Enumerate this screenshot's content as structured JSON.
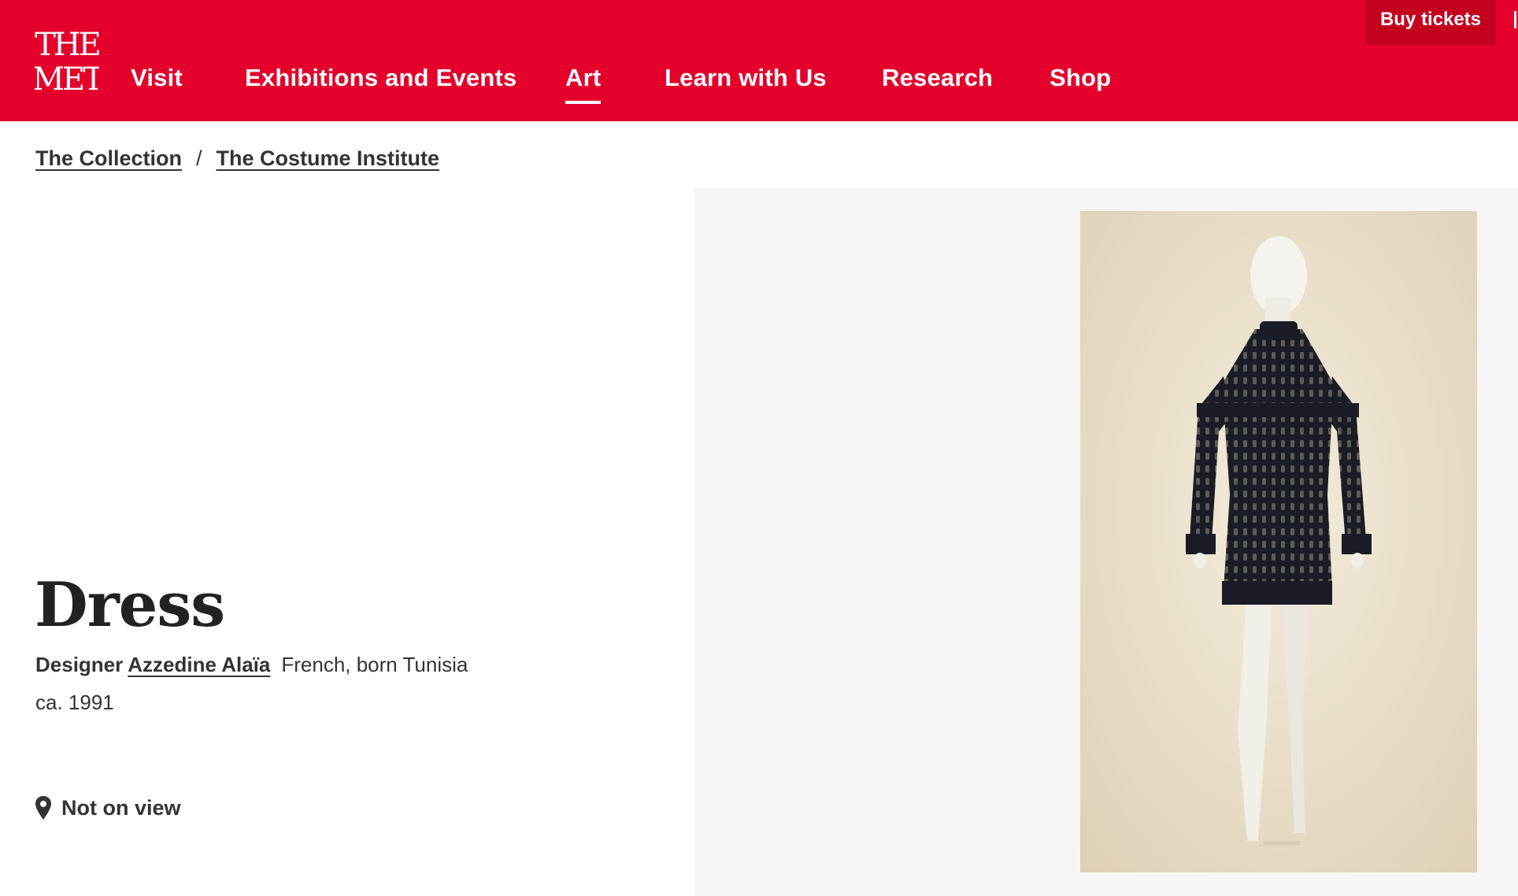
{
  "brand": {
    "logo_text_top": "THE",
    "logo_text_bottom": "MET",
    "color": "#e4002b"
  },
  "header": {
    "buy_tickets": "Buy tickets",
    "nav": [
      {
        "label": "Visit",
        "active": false
      },
      {
        "label": "Exhibitions and Events",
        "active": false
      },
      {
        "label": "Art",
        "active": true
      },
      {
        "label": "Learn with Us",
        "active": false
      },
      {
        "label": "Research",
        "active": false
      },
      {
        "label": "Shop",
        "active": false
      }
    ]
  },
  "breadcrumb": {
    "items": [
      "The Collection",
      "The Costume Institute"
    ],
    "separator": "/"
  },
  "artwork": {
    "title": "Dress",
    "role": "Designer",
    "designer": "Azzedine Alaïa",
    "nationality": "French, born Tunisia",
    "date": "ca. 1991",
    "view_status": "Not on view"
  },
  "icons": {
    "location": "map-pin-icon"
  },
  "colors": {
    "header": "#e4002b",
    "buy_tickets_bg": "#c4001f",
    "image_panel": "#f6f6f6",
    "text": "#333333"
  }
}
